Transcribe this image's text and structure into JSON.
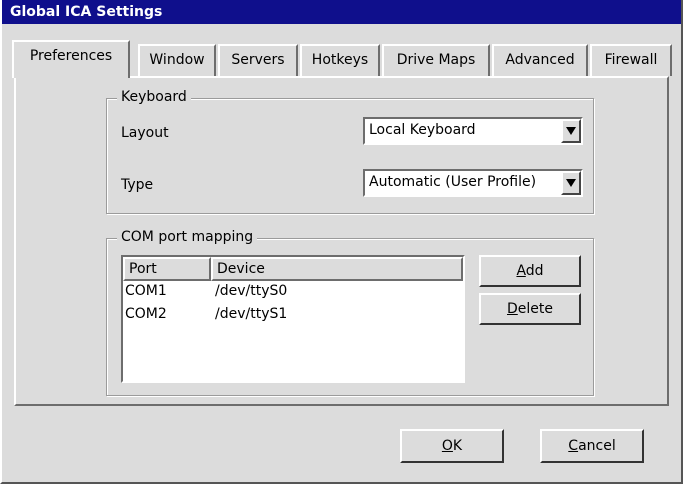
{
  "window": {
    "title": "Global ICA Settings"
  },
  "tabs": [
    {
      "label": "Preferences"
    },
    {
      "label": "Window"
    },
    {
      "label": "Servers"
    },
    {
      "label": "Hotkeys"
    },
    {
      "label": "Drive Maps"
    },
    {
      "label": "Advanced"
    },
    {
      "label": "Firewall"
    }
  ],
  "keyboard": {
    "group_title": "Keyboard",
    "layout_label": "Layout",
    "layout_value": "Local Keyboard",
    "type_label": "Type",
    "type_value": "Automatic (User Profile)"
  },
  "com": {
    "group_title": "COM port mapping",
    "columns": [
      "Port",
      "Device"
    ],
    "rows": [
      {
        "port": "COM1",
        "device": "/dev/ttyS0"
      },
      {
        "port": "COM2",
        "device": "/dev/ttyS1"
      }
    ],
    "add_label": {
      "mnemonic": "A",
      "rest": "dd"
    },
    "delete_label": {
      "mnemonic": "D",
      "rest": "elete"
    }
  },
  "footer": {
    "ok_label": {
      "mnemonic": "O",
      "rest": "K"
    },
    "cancel_label": {
      "mnemonic": "C",
      "rest": "ancel"
    }
  },
  "icons": {
    "dropdown": "triangle-down-icon"
  }
}
